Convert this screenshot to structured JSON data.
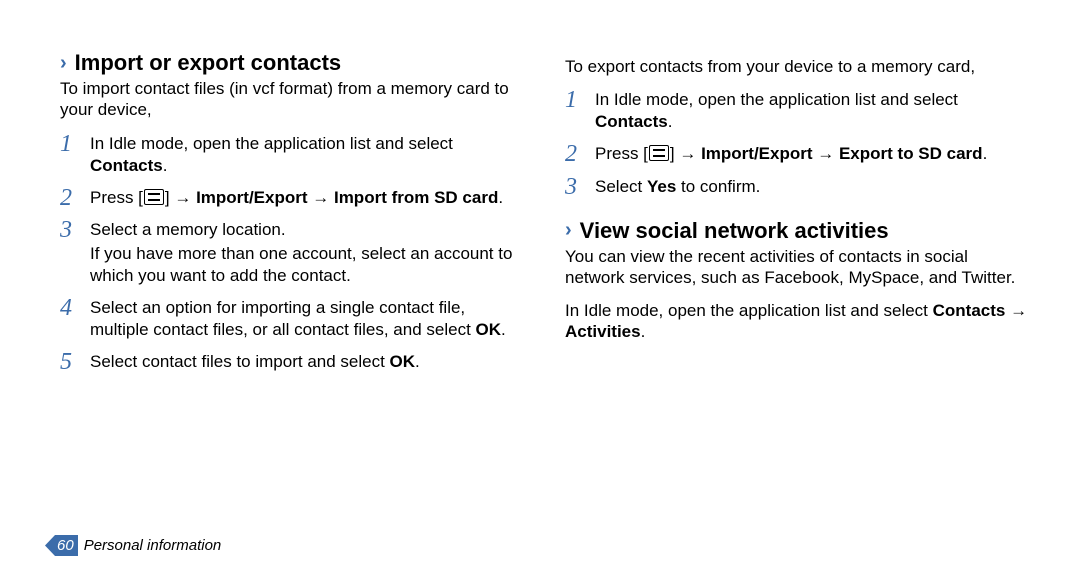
{
  "left": {
    "heading": "Import or export contacts",
    "intro": "To import contact files (in vcf format) from a memory card to your device,",
    "steps": [
      {
        "n": "1",
        "pre": "In Idle mode, open the application list and select ",
        "bold": "Contacts",
        "post": "."
      },
      {
        "n": "2",
        "pre": "Press [",
        "icon": true,
        "mid": "] → ",
        "bold": "Import/Export → Import from SD card",
        "post": "."
      },
      {
        "n": "3",
        "pre": "Select a memory location.",
        "sub": "If you have more than one account, select an account to which you want to add the contact."
      },
      {
        "n": "4",
        "pre": "Select an option for importing a single contact file, multiple contact files, or all contact files, and select ",
        "bold": "OK",
        "post": "."
      },
      {
        "n": "5",
        "pre": "Select contact files to import and select ",
        "bold": "OK",
        "post": "."
      }
    ]
  },
  "right": {
    "intro_top": "To export contacts from your device to a memory card,",
    "steps": [
      {
        "n": "1",
        "pre": "In Idle mode, open the application list and select ",
        "bold": "Contacts",
        "post": "."
      },
      {
        "n": "2",
        "pre": "Press [",
        "icon": true,
        "mid": "] → ",
        "bold": "Import/Export → Export to SD card",
        "post": "."
      },
      {
        "n": "3",
        "pre": "Select ",
        "bold": "Yes",
        "post": " to confirm."
      }
    ],
    "heading2": "View social network activities",
    "intro2": "You can view the recent activities of contacts in social network services, such as Facebook, MySpace, and Twitter.",
    "para2_pre": "In Idle mode, open the application list and select ",
    "para2_bold1": "Contacts",
    "para2_mid": " → ",
    "para2_bold2": "Activities",
    "para2_post": "."
  },
  "footer": {
    "page": "60",
    "section": "Personal information"
  }
}
